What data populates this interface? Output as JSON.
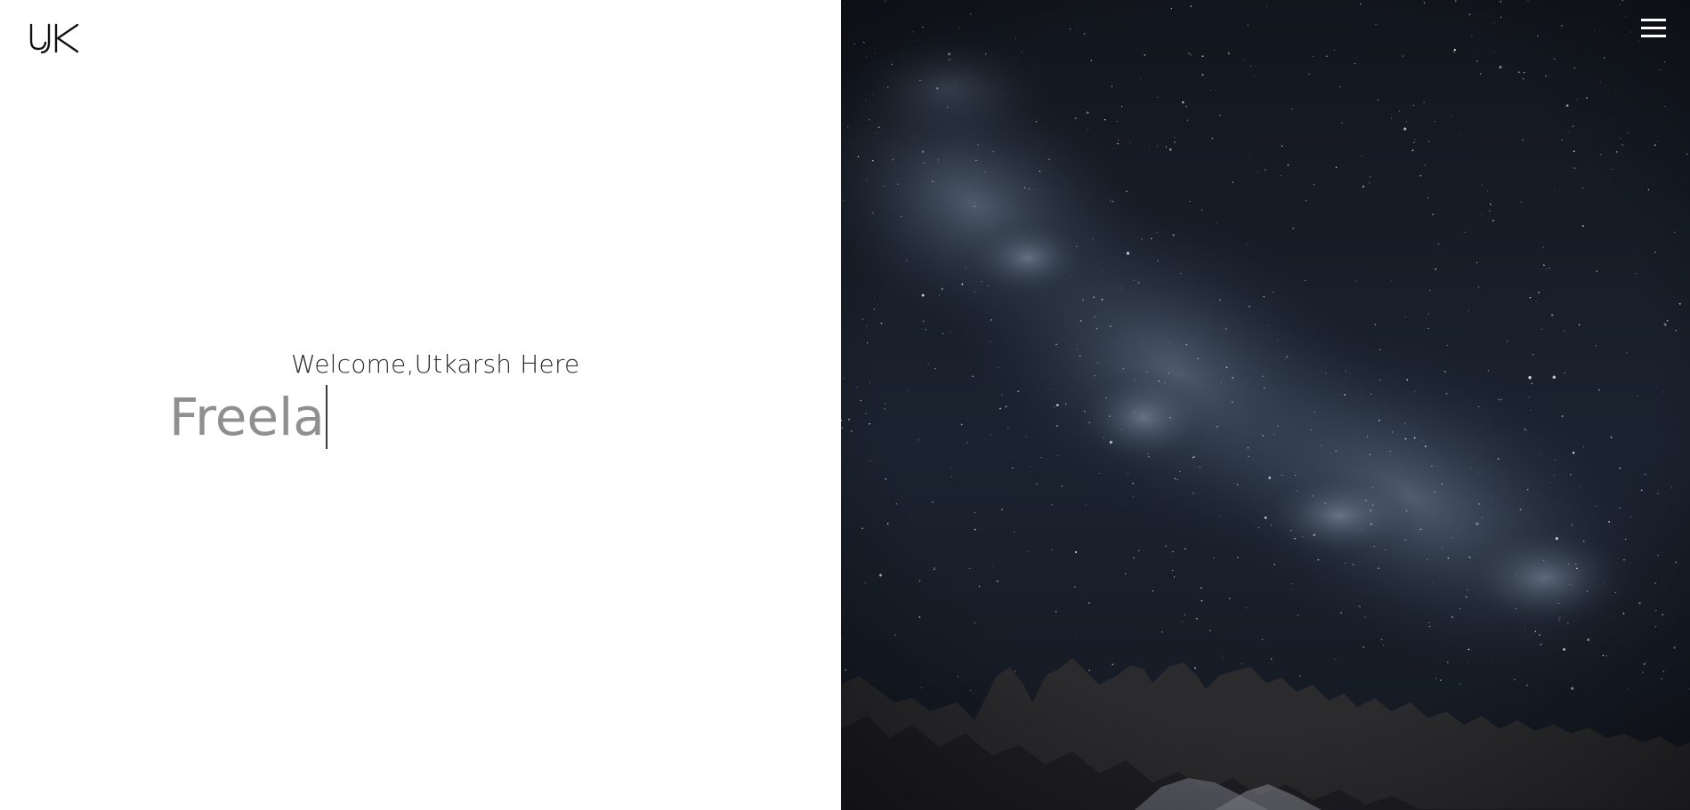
{
  "brand": {
    "logo_text": "UK",
    "logo_color": "#111111"
  },
  "hero": {
    "greeting": "Welcome,Utkarsh Here",
    "typed_text": "Freela",
    "typed_color": "#8f8f8f"
  },
  "nav": {
    "menu_icon": "hamburger-menu-icon",
    "menu_color": "#ffffff"
  },
  "background": {
    "subject": "starry-night-sky-over-mountains",
    "sky_color": "#141820",
    "milky_way_color": "#5b6b80",
    "mountain_color": "#2b2a2d"
  }
}
